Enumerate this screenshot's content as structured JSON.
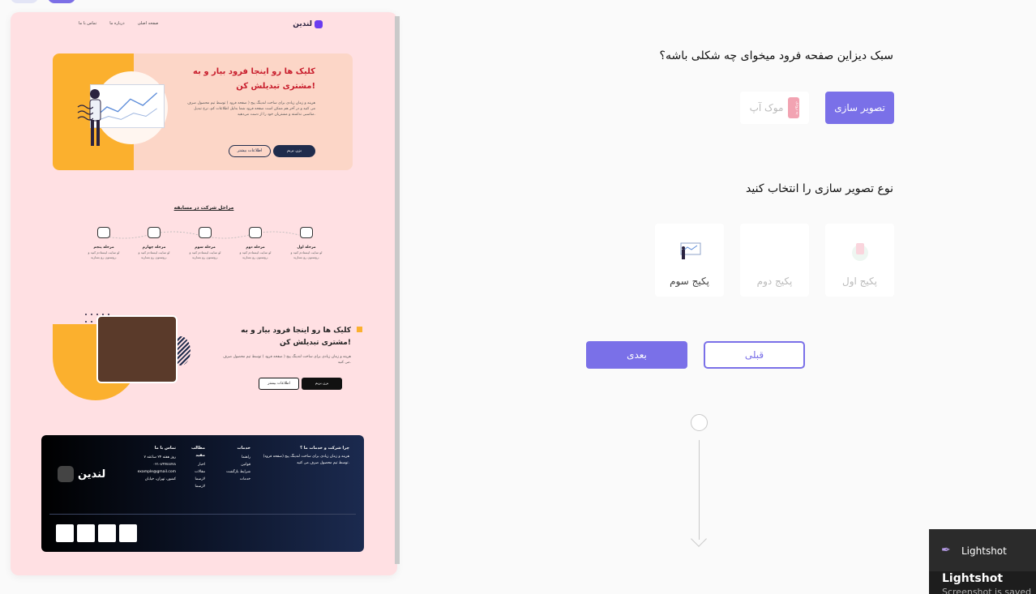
{
  "preview": {
    "nav": {
      "links": [
        "تماس با ما",
        "درباره ما",
        "صفحه اصلی"
      ],
      "logo": "لندین"
    },
    "hero": {
      "title": "کلیک ها رو اینجا فرود بیار و به مشتری تبدیلش کن!",
      "body": "هزینه و زمان زیادی برای ساخت لندینگ پیج ( صفحه فرود ) توسط تیم محصول صرف می کنید و در آخر هم ممکن است صفحه فرود شما بدلیل اطلاعات کم، نرخ تبدیل مناسبی نداشته و مشتریان خود را از دست می‌دهید.",
      "primary": "بزن بریم",
      "secondary": "اطلاعات بیشتر"
    },
    "steps": {
      "title": "مراحل شرکت در مسابقه",
      "items": [
        {
          "title": "مرحله اول",
          "desc": "لو سایت لیستادم کنید و روستون رو بسازید."
        },
        {
          "title": "مرحله دوم",
          "desc": "لو سایت لیستادم کنید و روستون رو بسازید."
        },
        {
          "title": "مرحله سوم",
          "desc": "لو سایت لیستادم کنید و روستون رو بسازید."
        },
        {
          "title": "مرحله چهارم",
          "desc": "لو سایت لیستادم کنید و روستون رو بسازید."
        },
        {
          "title": "مرحله پنجم",
          "desc": "لو سایت لیستادم کنید و روستون رو بسازید."
        }
      ]
    },
    "section3": {
      "title": "کلیک ها رو اینجا فرود بیار و به مشتری تبدیلش کن!",
      "body": "هزینه و زمان زیادی برای ساخت لندینگ پیج ( صفحه فرود ) توسط تیم محصول صرف می کنید.",
      "primary": "بزن بریم",
      "secondary": "اطلاعات بیشتر"
    },
    "footer": {
      "logo": "لندین",
      "about_title": "چرا شرکت و خدمات ما ؟",
      "about_body": "هزینه و زمان زیادی برای ساخت لندینگ پیج (صفحه فرود) توسط تیم محصول صرف می کنید.",
      "services_title": "خدمات",
      "services": [
        "راهنما",
        "قوانین",
        "شرایط بازگشت",
        "خدمات"
      ],
      "links_title": "مطالب مفید",
      "links": [
        "اخبار",
        "مقالات",
        "لارسما",
        "لارسما"
      ],
      "contact_title": "تماس با ما",
      "contact": [
        "۷ روز هفته ۲۴ ساعته",
        "۰۲۱-۸۹۹۷۸۷۷۸",
        "example@gmail.com",
        "کشور، تهران، خیابان"
      ]
    }
  },
  "form": {
    "q1": "سبک دیزاین صفحه فرود میخوای چه شکلی باشه؟",
    "style_options": [
      {
        "label": "تصویر سازی",
        "active": true
      },
      {
        "label": "موک آپ",
        "tag": "به زودی",
        "active": false
      }
    ],
    "q2": "نوع تصویر سازی را انتخاب کنید",
    "packages": [
      {
        "label": "پکیج اول",
        "selected": false
      },
      {
        "label": "پکیج دوم",
        "selected": false
      },
      {
        "label": "پکیج سوم",
        "selected": true
      }
    ],
    "next": "بعدی",
    "prev": "قبلی"
  },
  "toast": {
    "app": "Lightshot",
    "title": "Lightshot",
    "sub": "Screenshot is saved"
  },
  "colors": {
    "accent": "#7a70e8",
    "preview_bg": "#ffe0e3",
    "hero_bg": "#fcd6c7",
    "yellow": "#fbb02e",
    "navy": "#1f2c4c"
  }
}
